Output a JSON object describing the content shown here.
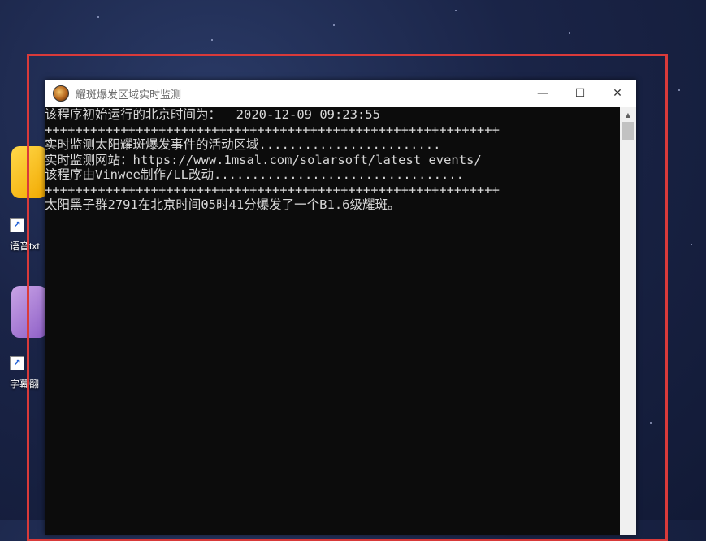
{
  "desktop": {
    "icons": [
      {
        "label": "语音txt"
      },
      {
        "label": "字幕翻"
      }
    ]
  },
  "window": {
    "title": "耀斑爆发区域实时监测",
    "icon": "sun-icon",
    "controls": {
      "minimize": "—",
      "maximize": "☐",
      "close": "✕"
    }
  },
  "console": {
    "lines": [
      "该程序初始运行的北京时间为：  2020-12-09 09:23:55",
      "++++++++++++++++++++++++++++++++++++++++++++++++++++++++++++",
      "实时监测太阳耀斑爆发事件的活动区域........................",
      "实时监测网站：https://www.1msal.com/solarsoft/latest_events/",
      "该程序由Vinwee制作/LL改动.................................",
      "++++++++++++++++++++++++++++++++++++++++++++++++++++++++++++",
      "太阳黑子群2791在北京时间05时41分爆发了一个B1.6级耀斑。"
    ]
  },
  "colors": {
    "frame": "#d93a3a",
    "console_bg": "#0c0c0c",
    "console_text": "#d8d8d8"
  }
}
